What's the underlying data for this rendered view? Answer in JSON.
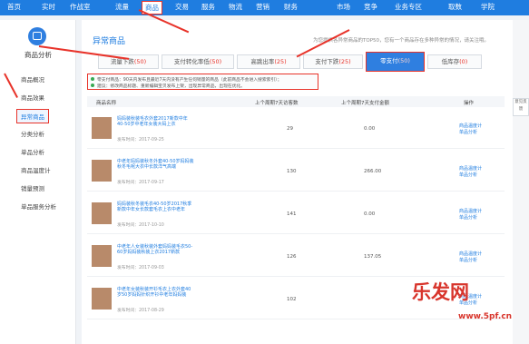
{
  "nav": [
    "首页",
    "实时",
    "作战室",
    "流量",
    "商品",
    "交易",
    "服务",
    "物流",
    "营销",
    "财务",
    "市场",
    "竞争",
    "业务专区",
    "取数",
    "学院"
  ],
  "sidebar": {
    "title": "商品分析",
    "items": [
      "商品概况",
      "商品效果",
      "异常商品",
      "分类分析",
      "单品分析",
      "商品温度计",
      "销量预测",
      "单品服务分析"
    ]
  },
  "main": {
    "title": "异常商品",
    "hint": "为您提供各异常商品的TOP50，您有一个商品存在多种异常的情况，请关注哦。"
  },
  "tabs": [
    {
      "label": "流量下跌",
      "count": "(50)"
    },
    {
      "label": "支付转化率低",
      "count": "(50)"
    },
    {
      "label": "高跳出率",
      "count": "(25)"
    },
    {
      "label": "支付下跌",
      "count": "(25)"
    },
    {
      "label": "零支付",
      "count": "(50)"
    },
    {
      "label": "低库存",
      "count": "(0)"
    }
  ],
  "notice": [
    "零支付商品：90天内发布且最近7天内没有产生任何销量的商品（此前商品不会进入搜索索引）；",
    "建议：修改商品标题、重新编辑宝贝发布上架，出现异常商品，出现在优化。"
  ],
  "table": {
    "headers": [
      "商品名称",
      "上个周期7天访客数",
      "上个周期7天支付金额",
      "操作"
    ],
    "rows": [
      {
        "name": "妈妈装秋装毛衣外套2017新款中年40-50岁中老年女装大码上衣",
        "date": "发布时间：2017-09-25",
        "v1": "29",
        "v2": "0.00"
      },
      {
        "name": "中老年妈妈装秋冬外套40-50岁妈妈装秋冬毛呢大衣中长款洋气高端",
        "date": "发布时间：2017-09-17",
        "v1": "130",
        "v2": "266.00"
      },
      {
        "name": "妈妈装秋冬装毛衣40-50岁2017秋季新款中年女长款套毛衣上衣中老年",
        "date": "发布时间：2017-10-10",
        "v1": "141",
        "v2": "0.00"
      },
      {
        "name": "中老年人女装秋装外套妈妈装毛衣50-60岁妈妈装秋装上衣2017新款",
        "date": "发布时间：2017-09-03",
        "v1": "126",
        "v2": "137.05"
      },
      {
        "name": "中老年女装秋装开衫毛衣上衣外套40岁50岁妈妈针织开衫中老年妈妈装",
        "date": "发布时间：2017-08-29",
        "v1": "102",
        "v2": ""
      }
    ],
    "action1": "商品温度计",
    "action2": "单品分析"
  },
  "right_widget": "意见反馈",
  "watermark": {
    "title": "乐发网",
    "url": "www.5pf.cn"
  }
}
